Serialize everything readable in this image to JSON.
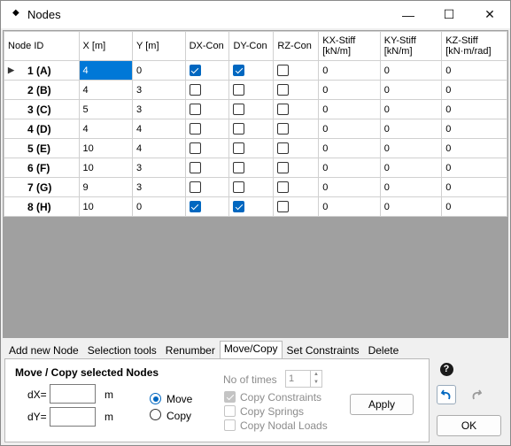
{
  "window": {
    "title": "Nodes",
    "icon": "app-icon",
    "minimize": "—",
    "maximize": "☐",
    "close": "✕"
  },
  "grid": {
    "columns": [
      "Node ID",
      "X [m]",
      "Y [m]",
      "DX-Con",
      "DY-Con",
      "RZ-Con",
      "KX-Stiff [kN/m]",
      "KY-Stiff [kN/m]",
      "KZ-Stiff [kN·m/rad]"
    ],
    "rows": [
      {
        "id": "1 (A)",
        "x": "4",
        "y": "0",
        "dx": true,
        "dy": true,
        "rz": false,
        "kx": "0",
        "ky": "0",
        "kz": "0",
        "current": true
      },
      {
        "id": "2 (B)",
        "x": "4",
        "y": "3",
        "dx": false,
        "dy": false,
        "rz": false,
        "kx": "0",
        "ky": "0",
        "kz": "0"
      },
      {
        "id": "3 (C)",
        "x": "5",
        "y": "3",
        "dx": false,
        "dy": false,
        "rz": false,
        "kx": "0",
        "ky": "0",
        "kz": "0"
      },
      {
        "id": "4 (D)",
        "x": "4",
        "y": "4",
        "dx": false,
        "dy": false,
        "rz": false,
        "kx": "0",
        "ky": "0",
        "kz": "0"
      },
      {
        "id": "5 (E)",
        "x": "10",
        "y": "4",
        "dx": false,
        "dy": false,
        "rz": false,
        "kx": "0",
        "ky": "0",
        "kz": "0"
      },
      {
        "id": "6 (F)",
        "x": "10",
        "y": "3",
        "dx": false,
        "dy": false,
        "rz": false,
        "kx": "0",
        "ky": "0",
        "kz": "0"
      },
      {
        "id": "7 (G)",
        "x": "9",
        "y": "3",
        "dx": false,
        "dy": false,
        "rz": false,
        "kx": "0",
        "ky": "0",
        "kz": "0"
      },
      {
        "id": "8 (H)",
        "x": "10",
        "y": "0",
        "dx": true,
        "dy": true,
        "rz": false,
        "kx": "0",
        "ky": "0",
        "kz": "0"
      }
    ]
  },
  "tabs": [
    "Add new Node",
    "Selection tools",
    "Renumber",
    "Move/Copy",
    "Set Constraints",
    "Delete"
  ],
  "active_tab": "Move/Copy",
  "move_copy": {
    "heading": "Move / Copy selected Nodes",
    "dx_label": "dX=",
    "dy_label": "dY=",
    "dx_value": "",
    "dy_value": "",
    "dx_unit": "m",
    "dy_unit": "m",
    "move_label": "Move",
    "copy_label": "Copy",
    "mode": "Move",
    "times_label": "No of times",
    "times_value": "1",
    "copy_constraints": "Copy Constraints",
    "copy_springs": "Copy Springs",
    "copy_loads": "Copy Nodal Loads",
    "apply": "Apply"
  },
  "side": {
    "help": "?",
    "undo": "undo-icon",
    "redo": "redo-icon",
    "ok": "OK"
  },
  "colors": {
    "selection": "#0078d7",
    "check": "#0067c0",
    "grid_bg": "#a0a0a0"
  }
}
